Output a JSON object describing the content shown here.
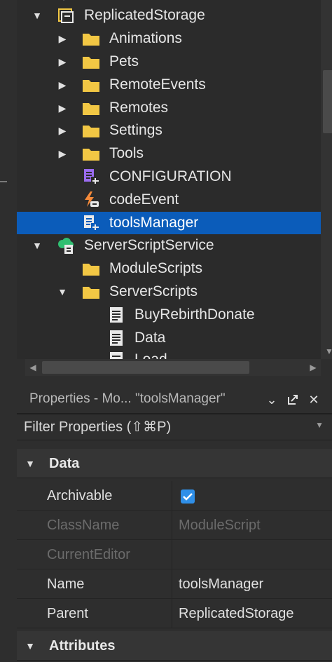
{
  "explorer": {
    "items": [
      {
        "label": "ReplicatedStorage",
        "icon": "replicated-storage-icon",
        "expanded": true
      },
      {
        "label": "Animations",
        "icon": "folder-icon",
        "expanded": false
      },
      {
        "label": "Pets",
        "icon": "folder-icon",
        "expanded": false
      },
      {
        "label": "RemoteEvents",
        "icon": "folder-icon",
        "expanded": false
      },
      {
        "label": "Remotes",
        "icon": "folder-icon",
        "expanded": false
      },
      {
        "label": "Settings",
        "icon": "folder-icon",
        "expanded": false
      },
      {
        "label": "Tools",
        "icon": "folder-icon",
        "expanded": false
      },
      {
        "label": "CONFIGURATION",
        "icon": "module-script-icon"
      },
      {
        "label": "codeEvent",
        "icon": "remote-event-icon"
      },
      {
        "label": "toolsManager",
        "icon": "module-script-icon",
        "selected": true
      },
      {
        "label": "ServerScriptService",
        "icon": "server-script-service-icon",
        "expanded": true
      },
      {
        "label": "ModuleScripts",
        "icon": "folder-icon"
      },
      {
        "label": "ServerScripts",
        "icon": "folder-icon",
        "expanded": true
      },
      {
        "label": "BuyRebirthDonate",
        "icon": "script-icon"
      },
      {
        "label": "Data",
        "icon": "script-icon"
      },
      {
        "label": "Load",
        "icon": "script-icon"
      }
    ]
  },
  "properties": {
    "title": "Properties - Mo... \"toolsManager\"",
    "filter_placeholder": "Filter Properties (⇧⌘P)",
    "sections": {
      "data": "Data",
      "attributes": "Attributes"
    },
    "rows": [
      {
        "name": "Archivable",
        "value": "",
        "checked": true
      },
      {
        "name": "ClassName",
        "value": "ModuleScript",
        "disabled": true
      },
      {
        "name": "CurrentEditor",
        "value": "",
        "disabled": true
      },
      {
        "name": "Name",
        "value": "toolsManager"
      },
      {
        "name": "Parent",
        "value": "ReplicatedStorage"
      }
    ]
  },
  "colors": {
    "selection": "#0b5cba",
    "folder": "#f2c744",
    "module": "#9b6cf0",
    "remote": "#f58a3a",
    "service": "#2fbf71",
    "checkbox": "#2f8fe8"
  }
}
